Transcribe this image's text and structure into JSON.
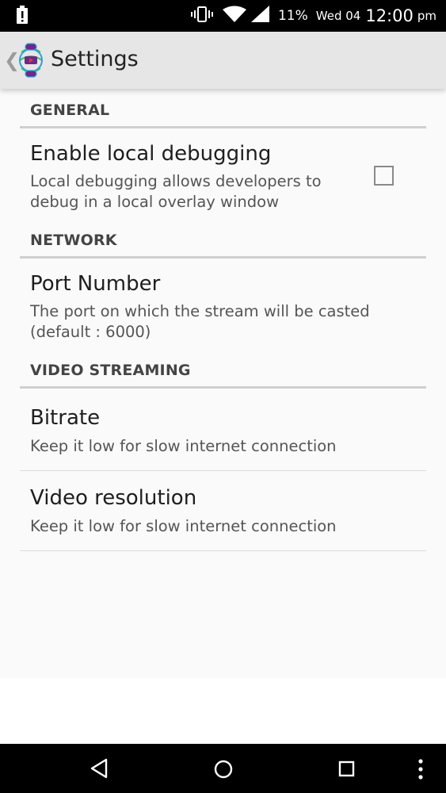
{
  "status_bar": {
    "battery_percent": "11%",
    "date": "Wed 04",
    "time": "12:00",
    "ampm": "pm",
    "icons": [
      "alert-icon",
      "vibrate-icon",
      "wifi-icon",
      "signal-icon"
    ]
  },
  "action_bar": {
    "title": "Settings",
    "back_glyph": "❮",
    "logo_icon": "app-logo-icon"
  },
  "sections": [
    {
      "header": "GENERAL",
      "items": [
        {
          "title": "Enable local debugging",
          "summary_line1": "Local debugging allows developers to",
          "summary_line2": "debug in a local overlay window",
          "checkbox_checked": false
        }
      ]
    },
    {
      "header": "NETWORK",
      "items": [
        {
          "title": "Port Number",
          "summary_line1": "The port on which the stream will be casted",
          "summary_line2": "(default : 6000)"
        }
      ]
    },
    {
      "header": "VIDEO STREAMING",
      "items": [
        {
          "title": "Bitrate",
          "summary": "Keep it low for slow internet connection"
        },
        {
          "title": "Video resolution",
          "summary": "Keep it low for slow internet connection"
        }
      ]
    }
  ],
  "nav_bar": {
    "icons": [
      "back-icon",
      "home-icon",
      "recents-icon",
      "overflow-menu-icon"
    ]
  },
  "colors": {
    "status_bar": "#000000",
    "action_bar": "#e6e6e6",
    "background": "#fafafa",
    "category_text": "#444444",
    "divider": "#cfcfcf"
  }
}
